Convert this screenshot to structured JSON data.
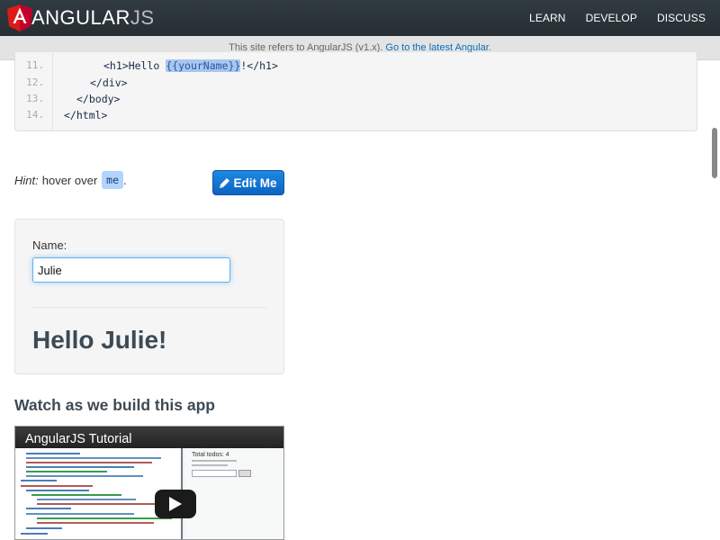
{
  "navbar": {
    "logo_main": "ANGULAR",
    "logo_js": "JS",
    "links": [
      "LEARN",
      "DEVELOP",
      "DISCUSS"
    ]
  },
  "banner": {
    "text": "This site refers to AngularJS (v1.x).",
    "link": "Go to the latest Angular"
  },
  "code": {
    "lines": [
      {
        "num": "11.",
        "before": "<h1>Hello ",
        "highlight": "{{yourName}}",
        "after": "!</h1>"
      },
      {
        "num": "12.",
        "text": "</div>"
      },
      {
        "num": "13.",
        "text": "</body>"
      },
      {
        "num": "14.",
        "text": "</html>"
      }
    ]
  },
  "hint": {
    "label": "Hint:",
    "text": "hover over",
    "me": "me",
    "period": "."
  },
  "edit_button": {
    "label": "Edit Me"
  },
  "demo": {
    "name_label": "Name:",
    "name_value": "Julie",
    "greeting": "Hello Julie!"
  },
  "watch": {
    "title": "Watch as we build this app",
    "video_title": "AngularJS Tutorial",
    "right_title": "Total todos: 4"
  },
  "colors": {
    "navbar": "#2b3339",
    "accent": "#0a6fb7",
    "button": "#1474d4",
    "logo_red": "#dd1b16"
  }
}
